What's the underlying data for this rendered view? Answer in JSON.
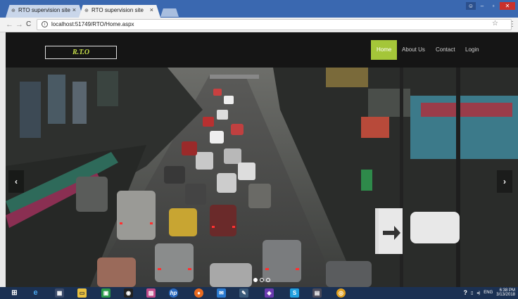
{
  "browser": {
    "tabs": [
      {
        "title": "RTO supervision site",
        "active": false
      },
      {
        "title": "RTO supervision site",
        "active": true
      }
    ],
    "close_glyph": "×",
    "address": "localhost:51749/RTO/Home.aspx",
    "win_controls": {
      "minimize": "–",
      "maximize": "▫",
      "close": "✕"
    }
  },
  "site": {
    "brand": "R.T.O",
    "nav": [
      {
        "label": "Home",
        "active": true
      },
      {
        "label": "About Us",
        "active": false
      },
      {
        "label": "Contact",
        "active": false
      },
      {
        "label": "Login",
        "active": false
      }
    ],
    "accent_color": "#a4c639",
    "carousel": {
      "prev_glyph": "‹",
      "next_glyph": "›",
      "slide_count": 3,
      "active_slide": 1,
      "image": "city-traffic-street-photo"
    }
  },
  "taskbar": {
    "time": "6:38 PM",
    "date": "3/13/2018",
    "language": "ENG",
    "apps": [
      "windows-start-icon",
      "ie-icon",
      "network-icon",
      "file-explorer-icon",
      "store-icon",
      "camera-icon",
      "photos-icon",
      "hp-icon",
      "firefox-icon",
      "outlook-icon",
      "pen-icon",
      "visual-studio-icon",
      "skype-icon",
      "calculator-icon",
      "chrome-icon"
    ]
  }
}
